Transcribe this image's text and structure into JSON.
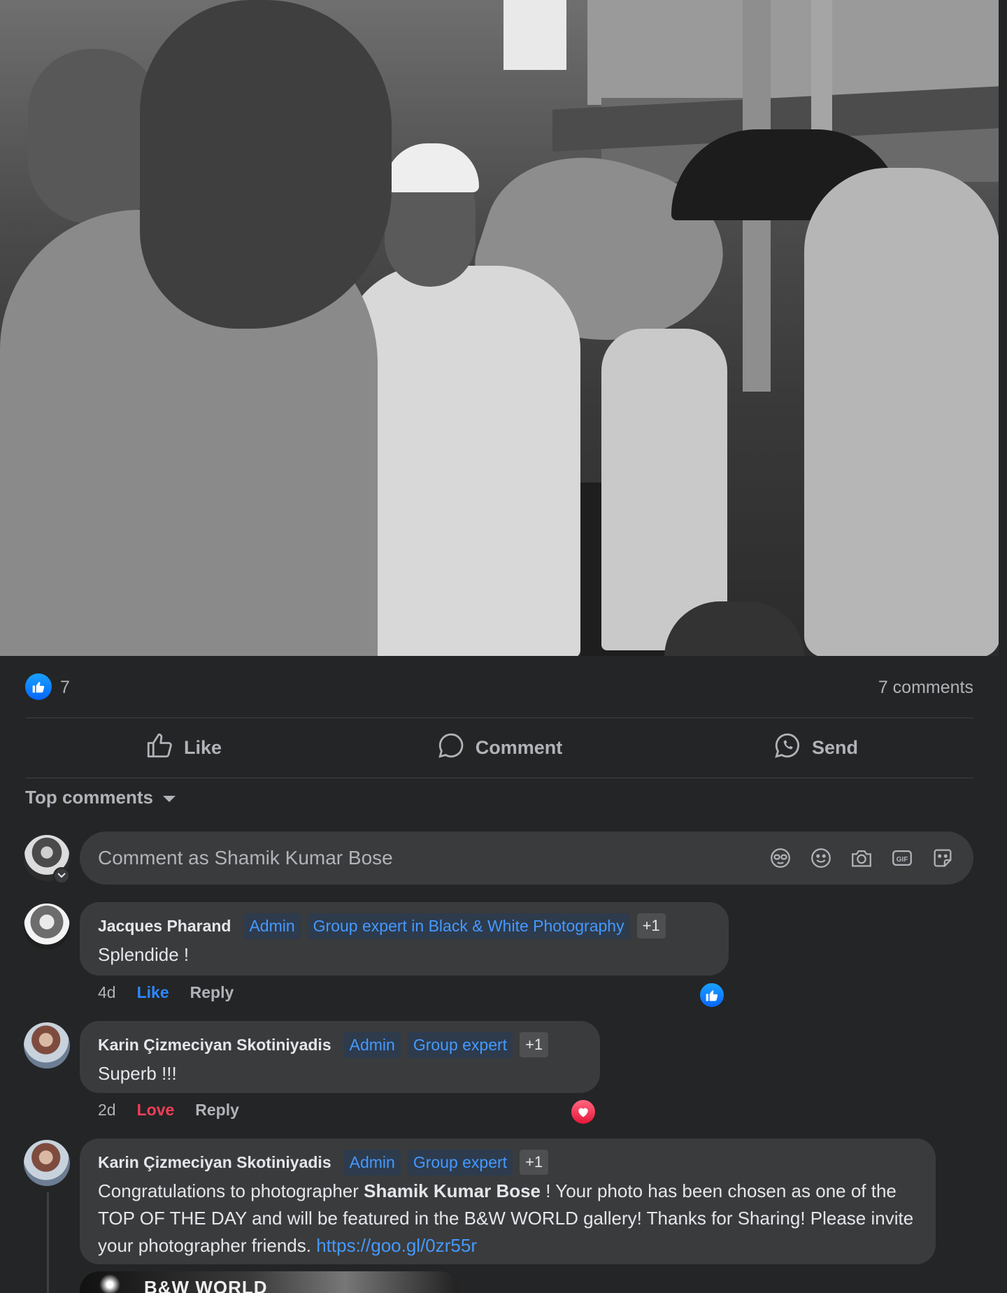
{
  "post": {
    "photo_alt": "",
    "reaction_count": "7",
    "comment_count_label": "7 comments"
  },
  "actions": {
    "like": "Like",
    "comment": "Comment",
    "send": "Send"
  },
  "comments_section": {
    "sort_label": "Top comments",
    "composer_placeholder": "Comment as Shamik Kumar Bose"
  },
  "comments": [
    {
      "author": "Jacques Pharand",
      "badges": [
        "Admin",
        "Group expert in Black & White Photography"
      ],
      "extra_badges": "+1",
      "text": "Splendide !",
      "time": "4d",
      "reaction_action": "Like",
      "reply": "Reply",
      "reaction": "like"
    },
    {
      "author": "Karin Çizmeciyan Skotiniyadis",
      "badges": [
        "Admin",
        "Group expert"
      ],
      "extra_badges": "+1",
      "text": "Superb !!!",
      "time": "2d",
      "reaction_action": "Love",
      "reply": "Reply",
      "reaction": "love"
    },
    {
      "author": "Karin Çizmeciyan Skotiniyadis",
      "badges": [
        "Admin",
        "Group expert"
      ],
      "extra_badges": "+1",
      "text_prefix": "Congratulations to photographer ",
      "text_bold": "Shamik Kumar Bose",
      "text_suffix": " ! Your photo has been chosen as one of the TOP OF THE DAY and will be featured in the B&W WORLD gallery! Thanks for Sharing! Please invite your photographer friends. ",
      "link": "https://goo.gl/0zr55r",
      "attachment_title": "B&W WORLD"
    }
  ],
  "colors": {
    "background": "#242526",
    "bubble": "#3a3b3c",
    "link": "#4599ff",
    "like_blue": "#2d88ff",
    "love_red": "#f33e58"
  },
  "icons": {
    "composer_tools": [
      "avatar-sticker-icon",
      "emoji-icon",
      "camera-icon",
      "gif-icon",
      "sticker-icon"
    ]
  }
}
